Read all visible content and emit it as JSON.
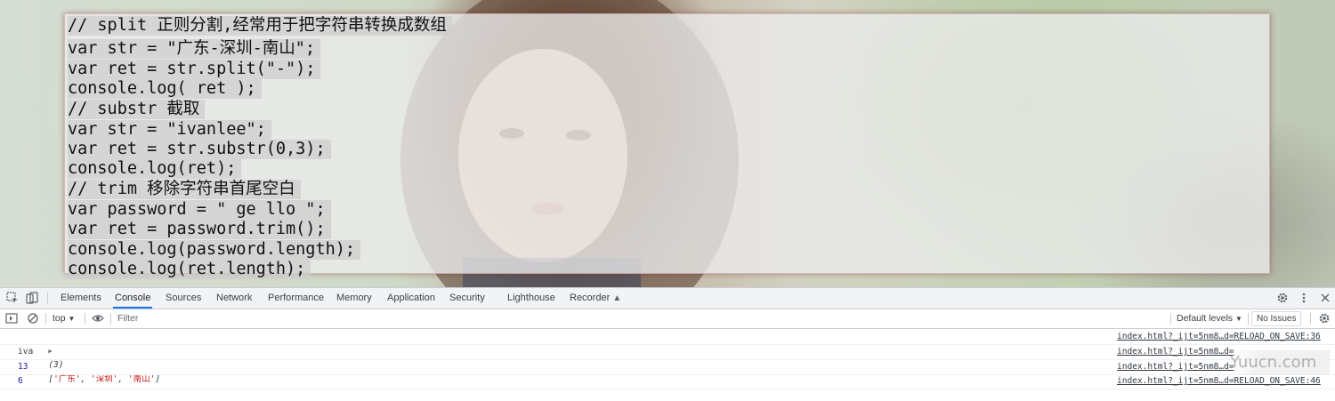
{
  "code": {
    "lines": [
      "// split 正则分割,经常用于把字符串转换成数组",
      "var str = \"广东-深圳-南山\";",
      "var ret = str.split(\"-\");",
      "console.log( ret );",
      "// substr 截取",
      "var str = \"ivanlee\";",
      "var ret = str.substr(0,3);",
      "console.log(ret);",
      "// trim 移除字符串首尾空白",
      "var password = \" ge llo \";",
      "var ret = password.trim();",
      "console.log(password.length);",
      "console.log(ret.length);"
    ]
  },
  "devtools": {
    "tabs": [
      "Elements",
      "Console",
      "Sources",
      "Network",
      "Performance",
      "Memory",
      "Application",
      "Security",
      "Lighthouse",
      "Recorder"
    ],
    "active_tab": "Console",
    "toolbar": {
      "context": "top",
      "filter_placeholder": "Filter",
      "default_levels": "Default levels",
      "no_issues": "No Issues"
    },
    "console": {
      "array_row": {
        "count": "(3)",
        "open": "[",
        "items": [
          "'广东'",
          "'深圳'",
          "'南山'"
        ],
        "close": "]",
        "source": "index.html?_ijt=5nm8…d=RELOAD_ON_SAVE:36"
      },
      "rows": [
        {
          "text": "iva",
          "kind": "plain",
          "source": "index.html?_ijt=5nm8…d="
        },
        {
          "text": "13",
          "kind": "num",
          "source": "index.html?_ijt=5nm8…d="
        },
        {
          "text": "6",
          "kind": "num",
          "source": "index.html?_ijt=5nm8…d=RELOAD_ON_SAVE:46"
        }
      ]
    }
  },
  "watermark": "Yuucn.com"
}
